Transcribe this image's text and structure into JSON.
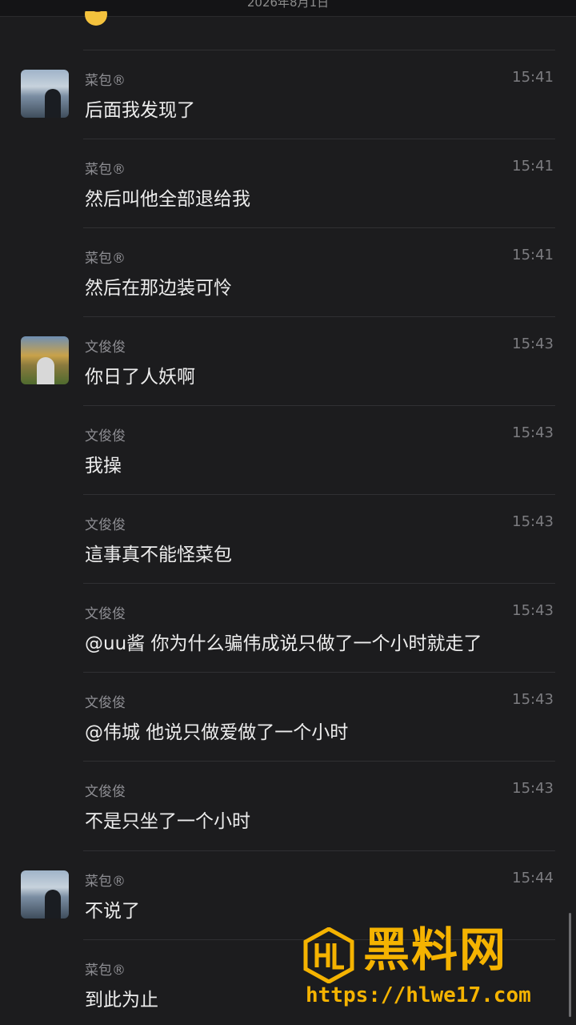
{
  "header": {
    "date": "2026年8月1日"
  },
  "colors": {
    "background": "#1c1c1e",
    "text": "#ededed",
    "muted": "#8e8e93",
    "watermark": "#f5b301"
  },
  "messages": [
    {
      "sender": "菜包®",
      "time": "15:41",
      "text": "后面我发现了",
      "show_avatar": true,
      "avatar": "avatar-caibao"
    },
    {
      "sender": "菜包®",
      "time": "15:41",
      "text": "然后叫他全部退给我",
      "show_avatar": false
    },
    {
      "sender": "菜包®",
      "time": "15:41",
      "text": "然后在那边装可怜",
      "show_avatar": false
    },
    {
      "sender": "文俊俊",
      "time": "15:43",
      "text": "你日了人妖啊",
      "show_avatar": true,
      "avatar": "avatar-wenjunjun"
    },
    {
      "sender": "文俊俊",
      "time": "15:43",
      "text": "我操",
      "show_avatar": false
    },
    {
      "sender": "文俊俊",
      "time": "15:43",
      "text": "這事真不能怪菜包",
      "show_avatar": false
    },
    {
      "sender": "文俊俊",
      "time": "15:43",
      "text": "@uu酱 你为什么骗伟成说只做了一个小时就走了",
      "show_avatar": false
    },
    {
      "sender": "文俊俊",
      "time": "15:43",
      "text": "@伟城 他说只做爱做了一个小时",
      "show_avatar": false
    },
    {
      "sender": "文俊俊",
      "time": "15:43",
      "text": "不是只坐了一个小时",
      "show_avatar": false
    },
    {
      "sender": "菜包®",
      "time": "15:44",
      "text": "不说了",
      "show_avatar": true,
      "avatar": "avatar-caibao"
    },
    {
      "sender": "菜包®",
      "time": "",
      "text": "到此为止",
      "show_avatar": false
    }
  ],
  "watermark": {
    "brand": "黑料网",
    "url": "https://hlwe17.com",
    "logo_icon": "hl-logo-icon"
  }
}
